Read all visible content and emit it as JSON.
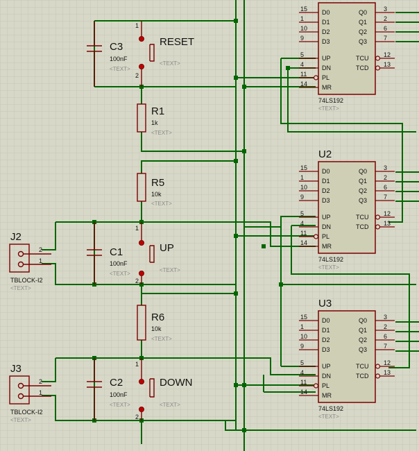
{
  "colors": {
    "background": "#d8d8c8",
    "grid": "#c6c6b6",
    "wire": "#006600",
    "component": "#7a0000",
    "chip_fill": "#cfcfb6",
    "text": "#111111",
    "placeholder": "#8a8a8a"
  },
  "placeholder_text": "<TEXT>",
  "capacitors": [
    {
      "ref": "C3",
      "value": "100nF"
    },
    {
      "ref": "C1",
      "value": "100nF"
    },
    {
      "ref": "C2",
      "value": "100nF"
    }
  ],
  "resistors": [
    {
      "ref": "R1",
      "value": "1k"
    },
    {
      "ref": "R5",
      "value": "10k"
    },
    {
      "ref": "R6",
      "value": "10k"
    }
  ],
  "switches": [
    {
      "label": "RESET",
      "pin_top": "1",
      "pin_bottom": "2"
    },
    {
      "label": "UP",
      "pin_top": "1",
      "pin_bottom": "2"
    },
    {
      "label": "DOWN",
      "pin_top": "1",
      "pin_bottom": "2"
    }
  ],
  "connectors": [
    {
      "ref": "J2",
      "part": "TBLOCK-I2",
      "pin_top": "2",
      "pin_bottom": "1"
    },
    {
      "ref": "J3",
      "part": "TBLOCK-I2",
      "pin_top": "2",
      "pin_bottom": "1"
    }
  ],
  "counters": [
    {
      "ref": "",
      "part": "74LS192"
    },
    {
      "ref": "U2",
      "part": "74LS192"
    },
    {
      "ref": "U3",
      "part": "74LS192"
    }
  ],
  "counter_pins": {
    "left": [
      {
        "num": "15",
        "name": "D0"
      },
      {
        "num": "1",
        "name": "D1"
      },
      {
        "num": "10",
        "name": "D2"
      },
      {
        "num": "9",
        "name": "D3"
      },
      {
        "num": "5",
        "name": "UP"
      },
      {
        "num": "4",
        "name": "DN"
      },
      {
        "num": "11",
        "name": "PL"
      },
      {
        "num": "14",
        "name": "MR"
      }
    ],
    "right_outputs": [
      {
        "num": "3",
        "name": "Q0"
      },
      {
        "num": "2",
        "name": "Q1"
      },
      {
        "num": "6",
        "name": "Q2"
      },
      {
        "num": "7",
        "name": "Q3"
      }
    ],
    "right_carry": [
      {
        "num": "12",
        "name": "TCU"
      },
      {
        "num": "13",
        "name": "TCD"
      }
    ]
  }
}
